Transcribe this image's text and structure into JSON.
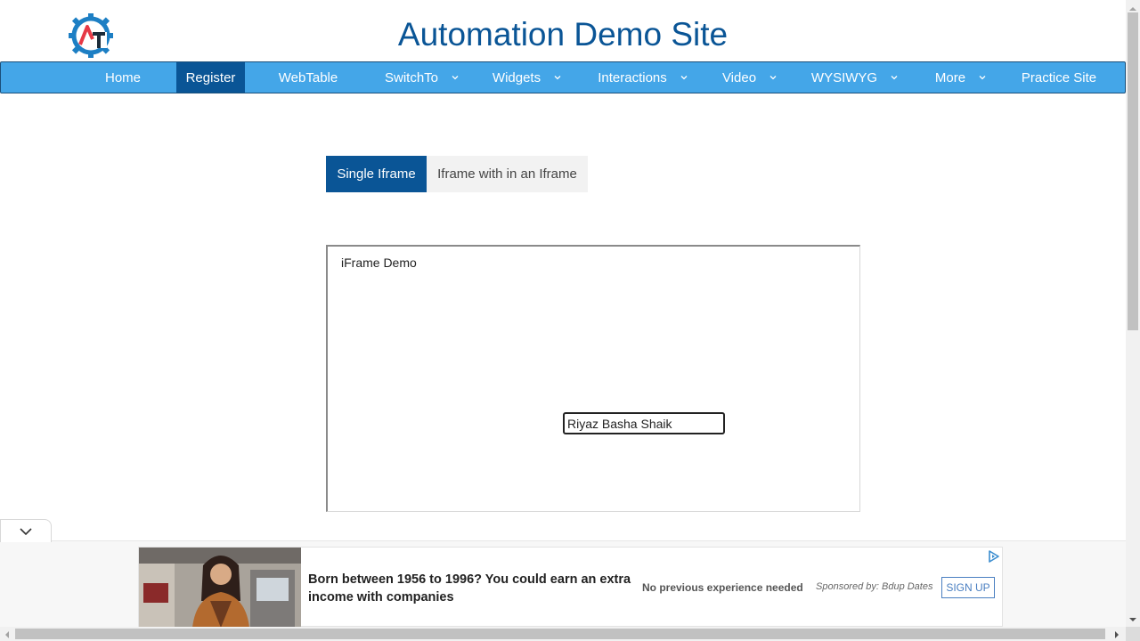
{
  "header": {
    "logo_icon": "gear-logo-icon",
    "title": "Automation Demo Site"
  },
  "nav": {
    "items": [
      {
        "label": "Home",
        "dropdown": false,
        "active": false
      },
      {
        "label": "Register",
        "dropdown": false,
        "active": true
      },
      {
        "label": "WebTable",
        "dropdown": false,
        "active": false
      },
      {
        "label": "SwitchTo",
        "dropdown": true,
        "active": false
      },
      {
        "label": "Widgets",
        "dropdown": true,
        "active": false
      },
      {
        "label": "Interactions",
        "dropdown": true,
        "active": false
      },
      {
        "label": "Video",
        "dropdown": true,
        "active": false
      },
      {
        "label": "WYSIWYG",
        "dropdown": true,
        "active": false
      },
      {
        "label": "More",
        "dropdown": true,
        "active": false
      },
      {
        "label": "Practice Site",
        "dropdown": false,
        "active": false
      }
    ]
  },
  "tabs": [
    {
      "label": "Single Iframe",
      "active": true
    },
    {
      "label": "Iframe with in an Iframe",
      "active": false
    }
  ],
  "iframe": {
    "title": "iFrame Demo",
    "input_value": "Riyaz Basha Shaik"
  },
  "ad": {
    "headline": "Born between 1956 to 1996? You could earn an extra income with companies",
    "subtext": "No previous experience needed",
    "sponsor": "Sponsored by: Bdup Dates",
    "cta": "SIGN UP"
  },
  "colors": {
    "brand_dark": "#0a5596",
    "nav_bg": "#44a6e8",
    "tab_inactive": "#f2f2f2"
  }
}
